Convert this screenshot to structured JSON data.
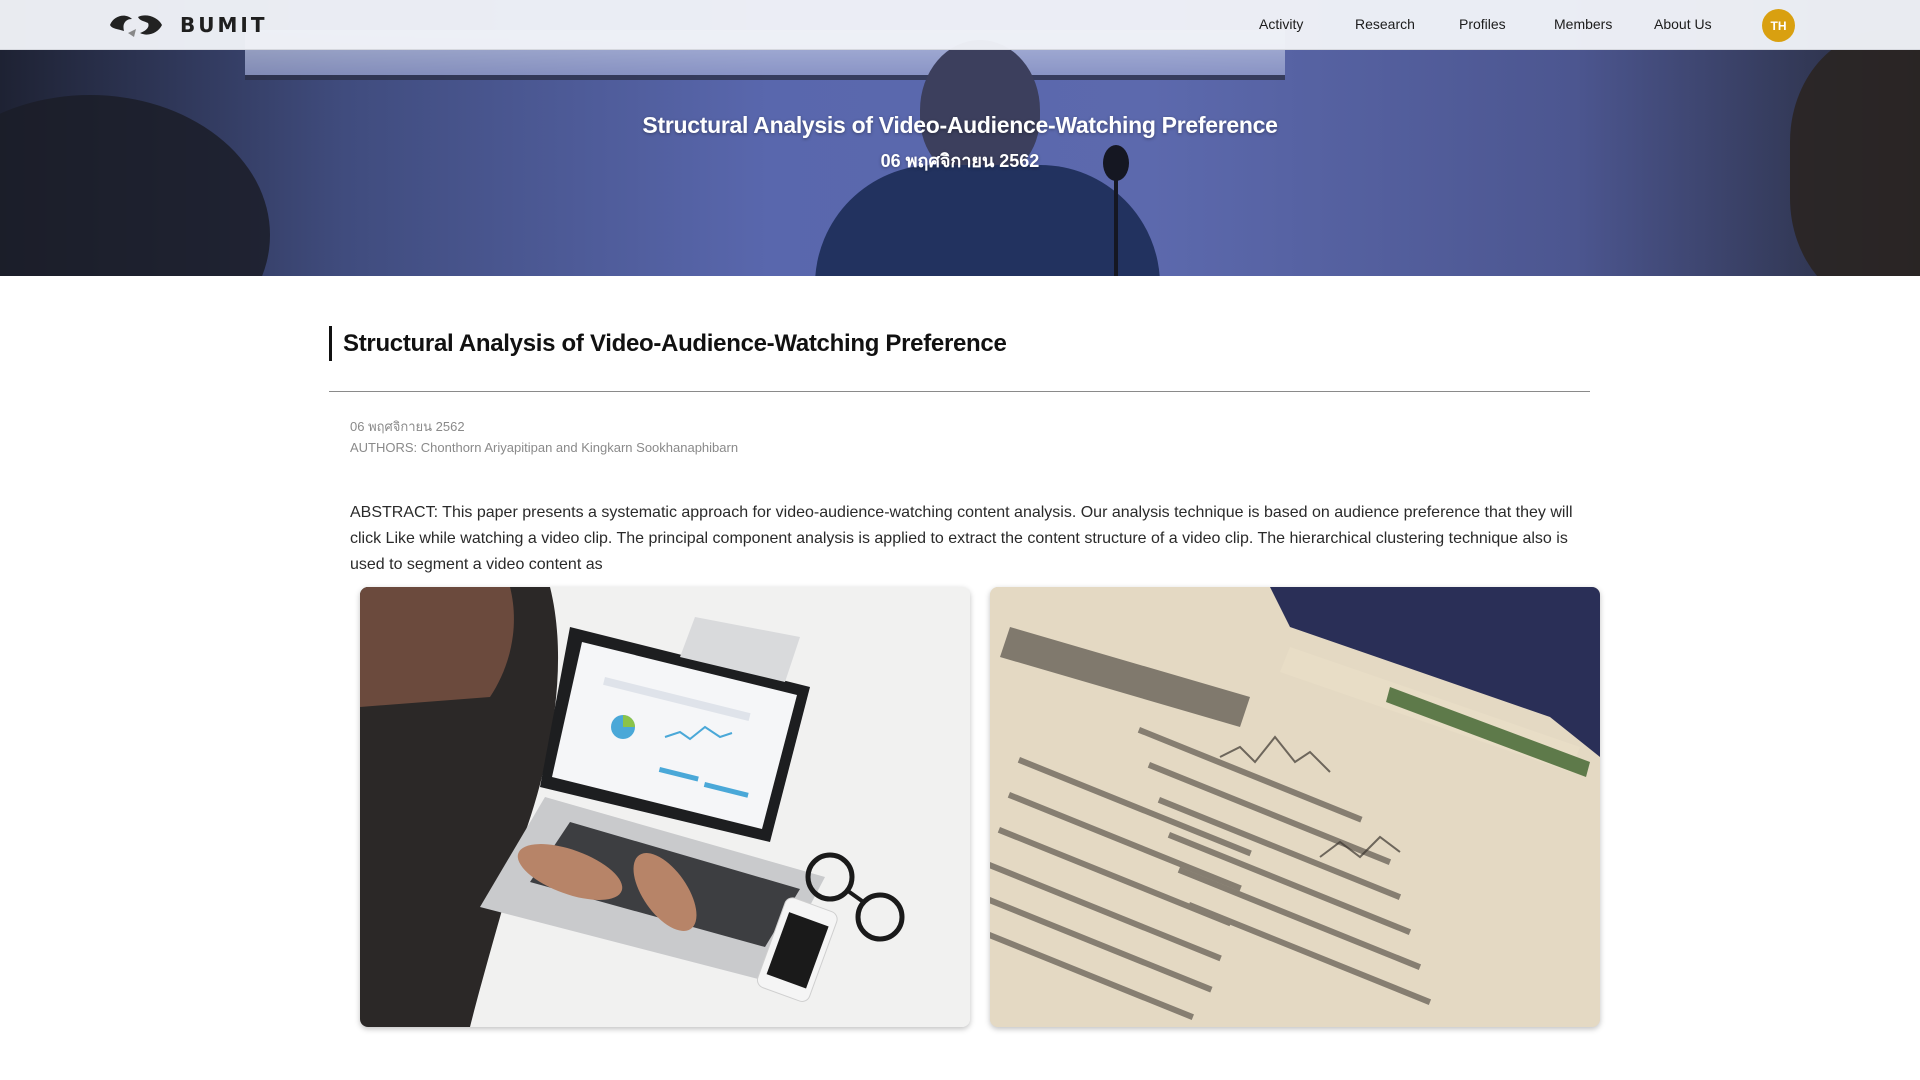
{
  "header": {
    "brand": "BUMIT",
    "nav": [
      {
        "label": "Activity"
      },
      {
        "label": "Research"
      },
      {
        "label": "Profiles"
      },
      {
        "label": "Members"
      },
      {
        "label": "About Us"
      }
    ],
    "lang_badge": "TH",
    "lang_badge_color": "#d9a010"
  },
  "hero": {
    "title": "Structural Analysis of Video-Audience-Watching Preference",
    "date": "06 พฤศจิกายน 2562"
  },
  "article": {
    "title": "Structural Analysis of Video-Audience-Watching Preference",
    "date": "06 พฤศจิกายน 2562",
    "authors": "AUTHORS: Chonthorn Ariyapitipan and Kingkarn Sookhanaphibarn",
    "abstract": "ABSTRACT: This paper presents a systematic approach for video-audience-watching content analysis. Our analysis technique is based on audience preference that they will click Like while watching a video clip. The principal component analysis is applied to extract the content structure of a video clip. The hierarchical clustering technique also is used to segment a video content as"
  },
  "photos": [
    {
      "subject": "person typing on laptop showing analytics dashboard"
    },
    {
      "subject": "newspaper financial pages with stock tables"
    }
  ],
  "icons": [
    "bumit-logo-icon"
  ]
}
